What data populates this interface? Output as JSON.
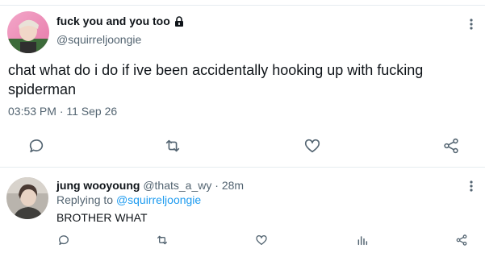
{
  "main_tweet": {
    "display_name": "fuck you and you too",
    "handle": "@squirreljoongie",
    "text": "chat what do i do if ive been accidentally hooking up with fucking spiderman",
    "timestamp": "03:53 PM · 11 Sep 26",
    "icons": {
      "lock": "lock-icon",
      "more": "more-vertical-icon",
      "reply": "comment-icon",
      "retweet": "retweet-icon",
      "like": "heart-icon",
      "share": "share-icon"
    }
  },
  "reply_tweet": {
    "display_name": "jung wooyoung",
    "handle": "@thats_a_wy",
    "separator": "·",
    "time": "28m",
    "replying_prefix": "Replying to",
    "replying_to": "@squirreljoongie",
    "text": "BROTHER WHAT",
    "icons": {
      "more": "more-vertical-icon",
      "reply": "comment-icon",
      "retweet": "retweet-icon",
      "like": "heart-icon",
      "analytics": "analytics-icon",
      "share": "share-icon"
    }
  },
  "colors": {
    "text_primary": "#0f1419",
    "text_secondary": "#536471",
    "link": "#1d9bf0",
    "icon": "#536471",
    "divider": "#e6ecf0"
  }
}
